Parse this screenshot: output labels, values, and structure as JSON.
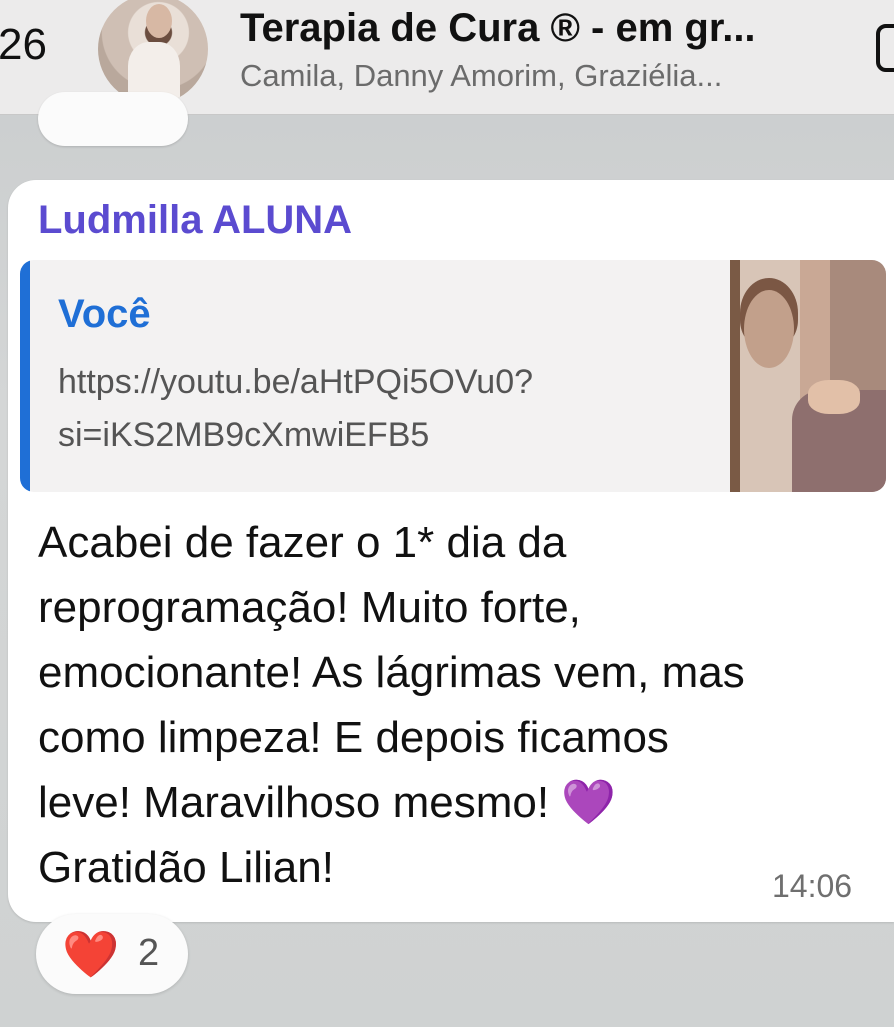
{
  "header": {
    "back_count": "26",
    "title": "Terapia de Cura ®  - em gr...",
    "subtitle": "Camila, Danny Amorim, Graziélia..."
  },
  "message": {
    "sender": "Ludmilla ALUNA",
    "quote": {
      "author": "Você",
      "text": "https://youtu.be/aHtPQi5OVu0?si=iKS2MB9cXmwiEFB5"
    },
    "lines": [
      "Acabei de fazer o 1* dia da",
      "reprogramação! Muito forte,",
      "emocionante! As lágrimas vem, mas",
      "como limpeza! E depois ficamos",
      "leve! Maravilhoso mesmo!",
      "Gratidão Lilian!"
    ],
    "emoji": "💜",
    "time": "14:06",
    "reaction": {
      "emoji": "❤️",
      "count": "2"
    }
  },
  "colors": {
    "sender": "#5b4bd0",
    "quote_accent": "#1f6fd6",
    "reaction_heart": "#e0241f",
    "purple_heart": "#8a3ee0"
  },
  "icons": [
    "call-icon",
    "heart-icon",
    "purple-heart-icon"
  ]
}
